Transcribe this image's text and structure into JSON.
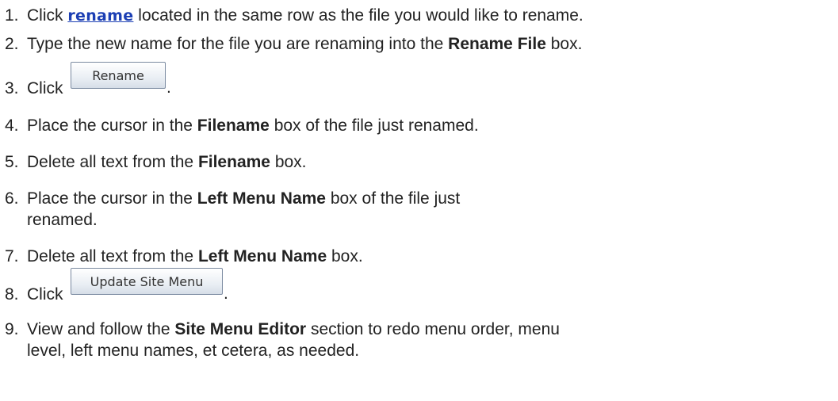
{
  "steps": [
    {
      "number": "1.",
      "click_text": "Click",
      "link_label": "rename",
      "rest": "located in the same row as the file you would like to rename."
    },
    {
      "number": "2.",
      "before": "Type the new name for the file you are renaming into the",
      "bold": "Rename File",
      "after": "box."
    },
    {
      "number": "3.",
      "click_text": "Click",
      "button_label": "Rename",
      "after": "."
    },
    {
      "number": "4.",
      "before": "Place the cursor in the",
      "bold": "Filename",
      "after": "box of the file just renamed."
    },
    {
      "number": "5.",
      "before": "Delete all text from the",
      "bold": "Filename",
      "after": "box."
    },
    {
      "number": "6.",
      "before": "Place the cursor in the",
      "bold": "Left Menu Name",
      "after": "box of the file just",
      "line2": "renamed."
    },
    {
      "number": "7.",
      "before": "Delete all text from the",
      "bold": "Left Menu Name",
      "after": "box."
    },
    {
      "number": "8.",
      "click_text": "Click",
      "button_label": "Update Site Menu",
      "after": "."
    },
    {
      "number": "9.",
      "before": "View and follow the",
      "bold": "Site Menu Editor",
      "after": "section to redo menu order, menu",
      "line2": "level, left menu names, et cetera, as needed."
    }
  ]
}
